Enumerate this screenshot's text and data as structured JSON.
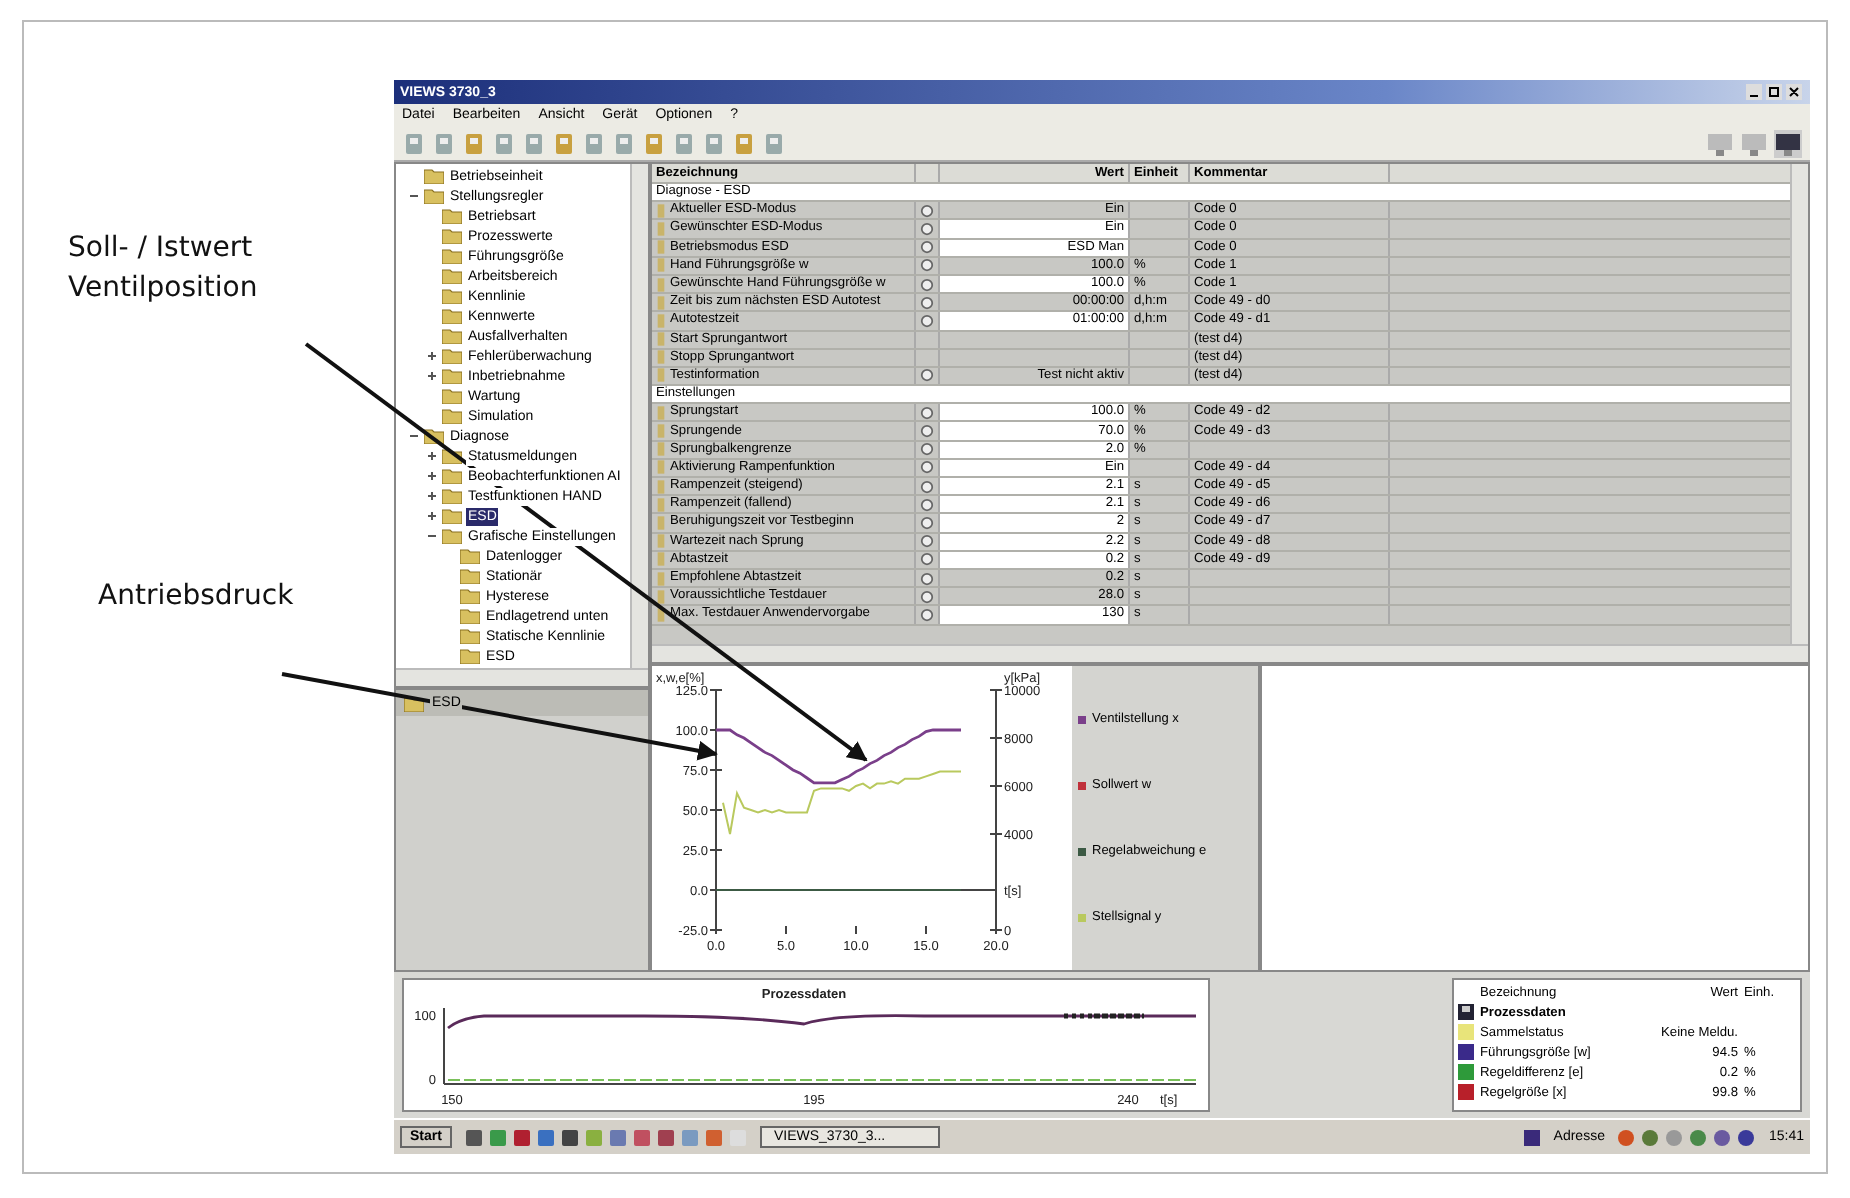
{
  "annotations": [
    {
      "label": "Soll- / Istwert Ventilposition"
    },
    {
      "label": "Antriebsdruck"
    }
  ],
  "window": {
    "title": "VIEWS 3730_3"
  },
  "menu": [
    "Datei",
    "Bearbeiten",
    "Ansicht",
    "Gerät",
    "Optionen",
    "?"
  ],
  "tree": [
    {
      "label": "Betriebseinheit"
    },
    {
      "label": "Stellungsregler",
      "expanded": true,
      "children": [
        {
          "label": "Betriebsart"
        },
        {
          "label": "Prozesswerte"
        },
        {
          "label": "Führungsgröße"
        },
        {
          "label": "Arbeitsbereich"
        },
        {
          "label": "Kennlinie"
        },
        {
          "label": "Kennwerte"
        },
        {
          "label": "Ausfallverhalten"
        },
        {
          "label": "Fehlerüberwachung",
          "expanded": false
        },
        {
          "label": "Inbetriebnahme",
          "expanded": false
        },
        {
          "label": "Wartung"
        },
        {
          "label": "Simulation"
        }
      ]
    },
    {
      "label": "Diagnose",
      "expanded": true,
      "children": [
        {
          "label": "Statusmeldungen",
          "expanded": false
        },
        {
          "label": "Beobachterfunktionen AI",
          "expanded": false
        },
        {
          "label": "Testfunktionen HAND",
          "expanded": false
        },
        {
          "label": "ESD",
          "expanded": false,
          "selected": true
        },
        {
          "label": "Grafische Einstellungen",
          "expanded": true,
          "children": [
            {
              "label": "Datenlogger"
            },
            {
              "label": "Stationär"
            },
            {
              "label": "Hysterese"
            },
            {
              "label": "Endlagetrend unten"
            },
            {
              "label": "Statische Kennlinie"
            },
            {
              "label": "ESD"
            }
          ]
        }
      ]
    }
  ],
  "lower_panel": {
    "item": "ESD"
  },
  "table": {
    "columns": [
      "Bezeichnung",
      "Wert",
      "Einheit",
      "Kommentar"
    ],
    "groups": [
      {
        "title": "Diagnose - ESD",
        "rows": [
          {
            "name": "Aktueller ESD-Modus",
            "value": "Ein",
            "comment": "Code 0",
            "editable": false,
            "locked": true
          },
          {
            "name": "Gewünschter ESD-Modus",
            "value": "Ein",
            "comment": "Code 0",
            "editable": true,
            "locked": true
          },
          {
            "name": "Betriebsmodus ESD",
            "value": "ESD Man",
            "comment": "Code 0",
            "editable": true,
            "locked": true
          },
          {
            "name": "Hand Führungsgröße w",
            "value": "100.0",
            "unit": "%",
            "comment": "Code 1",
            "editable": false,
            "locked": true
          },
          {
            "name": "Gewünschte Hand Führungsgröße w",
            "value": "100.0",
            "unit": "%",
            "comment": "Code 1",
            "editable": true,
            "locked": true
          },
          {
            "name": "Zeit bis zum nächsten ESD Autotest",
            "value": "00:00:00",
            "unit": "d,h:m",
            "comment": "Code 49 - d0",
            "editable": false,
            "locked": true
          },
          {
            "name": "Autotestzeit",
            "value": "01:00:00",
            "unit": "d,h:m",
            "comment": "Code 49 - d1",
            "editable": true,
            "locked": true
          },
          {
            "name": "Start Sprungantwort",
            "comment": "(test d4)",
            "editable": false,
            "locked": false
          },
          {
            "name": "Stopp Sprungantwort",
            "comment": "(test d4)",
            "editable": false,
            "locked": false
          },
          {
            "name": "Testinformation",
            "value": "Test nicht aktiv",
            "comment": "(test d4)",
            "editable": false,
            "locked": true
          }
        ]
      },
      {
        "title": "Einstellungen",
        "rows": [
          {
            "name": "Sprungstart",
            "value": "100.0",
            "unit": "%",
            "comment": "Code 49 - d2",
            "editable": true,
            "locked": true
          },
          {
            "name": "Sprungende",
            "value": "70.0",
            "unit": "%",
            "comment": "Code 49 - d3",
            "editable": true,
            "locked": true
          },
          {
            "name": "Sprungbalkengrenze",
            "value": "2.0",
            "unit": "%",
            "editable": true,
            "locked": true
          },
          {
            "name": "Aktivierung Rampenfunktion",
            "value": "Ein",
            "comment": "Code 49 - d4",
            "editable": true,
            "locked": true
          },
          {
            "name": "Rampenzeit (steigend)",
            "value": "2.1",
            "unit": "s",
            "comment": "Code 49 - d5",
            "editable": true,
            "locked": true
          },
          {
            "name": "Rampenzeit (fallend)",
            "value": "2.1",
            "unit": "s",
            "comment": "Code 49 - d6",
            "editable": true,
            "locked": true
          },
          {
            "name": "Beruhigungszeit vor Testbeginn",
            "value": "2",
            "unit": "s",
            "comment": "Code 49 - d7",
            "editable": true,
            "locked": true
          },
          {
            "name": "Wartezeit nach Sprung",
            "value": "2.2",
            "unit": "s",
            "comment": "Code 49 - d8",
            "editable": true,
            "locked": true
          },
          {
            "name": "Abtastzeit",
            "value": "0.2",
            "unit": "s",
            "comment": "Code 49 - d9",
            "editable": true,
            "locked": true
          },
          {
            "name": "Empfohlene Abtastzeit",
            "value": "0.2",
            "unit": "s",
            "editable": false,
            "locked": true
          },
          {
            "name": "Voraussichtliche Testdauer",
            "value": "28.0",
            "unit": "s",
            "editable": false,
            "locked": true
          },
          {
            "name": "Max. Testdauer Anwendervorgabe",
            "value": "130",
            "unit": "s",
            "editable": true,
            "locked": true
          }
        ]
      }
    ]
  },
  "chart": {
    "chart_data": {
      "type": "line",
      "xlabel": "t[s]",
      "ylabel": "x,w,e[%]",
      "y2label": "y[kPa]",
      "x": [
        0,
        0.5,
        1,
        1.5,
        2,
        2.5,
        3,
        3.5,
        4,
        4.5,
        5,
        5.5,
        6,
        6.5,
        7,
        7.5,
        8,
        8.5,
        9,
        9.5,
        10,
        10.5,
        11,
        11.5,
        12,
        12.5,
        13,
        13.5,
        14,
        14.5,
        15,
        15.5,
        16,
        16.5,
        17,
        17.5
      ],
      "xlim": [
        0,
        20
      ],
      "ylim": [
        -25,
        125
      ],
      "y2lim": [
        0,
        10000
      ],
      "xticks": [
        {
          "value": 0,
          "label": "0.0"
        },
        {
          "value": 5,
          "label": "5.0"
        },
        {
          "value": 10,
          "label": "10.0"
        },
        {
          "value": 15,
          "label": "15.0"
        },
        {
          "value": 20,
          "label": "20.0"
        }
      ],
      "yticks": [
        {
          "value": -25,
          "label": "-25.0"
        },
        {
          "value": 0,
          "label": "0.0"
        },
        {
          "value": 25,
          "label": "25.0"
        },
        {
          "value": 50,
          "label": "50.0"
        },
        {
          "value": 75,
          "label": "75.0"
        },
        {
          "value": 100,
          "label": "100.0"
        },
        {
          "value": 125,
          "label": "125.0"
        }
      ],
      "y2ticks": [
        0,
        4000,
        6000,
        8000,
        10000
      ],
      "series": [
        {
          "name": "Ventilstellung x",
          "color": "#7a3f8a",
          "axis": "y",
          "values": [
            100,
            100,
            100,
            97,
            95,
            92,
            89,
            86,
            84,
            81,
            78,
            75,
            73,
            70,
            67,
            67,
            67,
            67,
            69,
            71,
            74,
            76,
            79,
            81,
            84,
            86,
            89,
            91,
            94,
            96,
            99,
            100,
            100,
            100,
            100,
            100
          ]
        },
        {
          "name": "Sollwert w",
          "color": "#c0303a",
          "axis": "y",
          "values": [
            null,
            null,
            null,
            null,
            null,
            null,
            null,
            null,
            null,
            null,
            null,
            null,
            null,
            null,
            null,
            null,
            null,
            null,
            null,
            null,
            null,
            null,
            null,
            null,
            null,
            null,
            null,
            null,
            null,
            null,
            null,
            null,
            null,
            null,
            null,
            null
          ]
        },
        {
          "name": "Regelabweichung e",
          "color": "#3c5a44",
          "axis": "y",
          "values": [
            0,
            0,
            0,
            0,
            0,
            0,
            0,
            0,
            0,
            0,
            0,
            0,
            0,
            0,
            0,
            0,
            0,
            0,
            0,
            0,
            0,
            0,
            0,
            0,
            0,
            0,
            0,
            0,
            0,
            0,
            0,
            0,
            0,
            0,
            0,
            0
          ]
        },
        {
          "name": "Stellsignal y",
          "color": "#b9c95e",
          "axis": "y2",
          "values": [
            null,
            5300,
            4000,
            5700,
            5100,
            5000,
            4900,
            5000,
            4900,
            5000,
            4900,
            4900,
            4900,
            4900,
            5800,
            5900,
            5900,
            5900,
            5900,
            5800,
            6000,
            6100,
            5900,
            6100,
            6100,
            6200,
            6100,
            6300,
            6300,
            6300,
            6400,
            6500,
            6600,
            6600,
            6600,
            6600
          ]
        }
      ]
    }
  },
  "process_chart": {
    "title": "Prozessdaten",
    "yticks": [
      "100",
      "0"
    ],
    "xticks": [
      "150",
      "195",
      "240"
    ],
    "xlabel": "t[s]"
  },
  "process_table": {
    "columns": [
      "Bezeichnung",
      "Wert",
      "Einh."
    ],
    "group": "Prozessdaten",
    "rows": [
      {
        "name": "Sammelstatus",
        "value": "Keine Meldu.",
        "color": "#e8e47a"
      },
      {
        "name": "Führungsgröße [w]",
        "value": "94.5",
        "unit": "%",
        "color": "#3a2a8a"
      },
      {
        "name": "Regeldifferenz [e]",
        "value": "0.2",
        "unit": "%",
        "color": "#2e9a3a"
      },
      {
        "name": "Regelgröße [x]",
        "value": "99.8",
        "unit": "%",
        "color": "#b8202a"
      }
    ]
  },
  "taskbar": {
    "start": "Start",
    "task": "VIEWS_3730_3...",
    "address": "Adresse",
    "clock": "15:41"
  }
}
